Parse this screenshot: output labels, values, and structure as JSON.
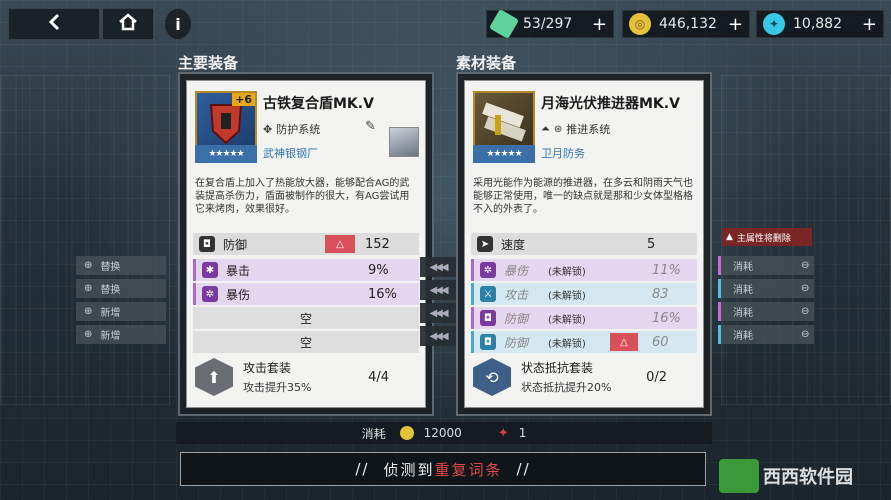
{
  "topbar": {
    "back_icon": "back-arrow-icon",
    "home_icon": "home-icon",
    "info_icon": "info-icon",
    "resources": [
      {
        "name": "energy",
        "value": "53/297",
        "color": "#5fd39b"
      },
      {
        "name": "coins",
        "value": "446,132",
        "color": "#e2c23a"
      },
      {
        "name": "crystals",
        "value": "10,882",
        "color": "#36c8e6"
      }
    ]
  },
  "sections": {
    "main_title": "主要装备",
    "material_title": "素材装备"
  },
  "main_item": {
    "level": "+6",
    "name": "古铁复合盾MK.V",
    "system": "防护系统",
    "stars": "★★★★★",
    "maker": "武神银钢厂",
    "description": "在复合盾上加入了热能放大器，能够配合AG的武装提高杀伤力，盾面被制作的很大，有AG尝试用它来烤肉，效果很好。",
    "main_stat": {
      "label": "防御",
      "value": "152"
    },
    "sub_stats": [
      {
        "label": "暴击",
        "value": "9%"
      },
      {
        "label": "暴伤",
        "value": "16%"
      },
      {
        "label": "空",
        "value": ""
      },
      {
        "label": "空",
        "value": ""
      }
    ],
    "suit": {
      "name": "攻击套装",
      "desc": "攻击提升35%",
      "count": "4/4"
    }
  },
  "material_item": {
    "name": "月海光伏推进器MK.V",
    "system": "推进系统",
    "stars": "★★★★★",
    "maker": "卫月防务",
    "description": "采用光能作为能源的推进器，在多云和阴雨天气也能够正常使用，唯一的缺点就是那和少女体型格格不入的外表了。",
    "main_stat": {
      "label": "速度",
      "value": "5"
    },
    "sub_stats": [
      {
        "label": "暴伤",
        "state": "(未解锁)",
        "value": "11%"
      },
      {
        "label": "攻击",
        "state": "(未解锁)",
        "value": "83"
      },
      {
        "label": "防御",
        "state": "(未解锁)",
        "value": "16%"
      },
      {
        "label": "防御",
        "state": "(未解锁)",
        "value": "60"
      }
    ],
    "suit": {
      "name": "状态抵抗套装",
      "desc": "状态抵抗提升20%",
      "count": "0/2"
    }
  },
  "left_side": [
    "替换",
    "替换",
    "新增",
    "新增"
  ],
  "right_side": [
    "消耗",
    "消耗",
    "消耗",
    "消耗"
  ],
  "warning_badge": "主属性将删除",
  "cost": {
    "label": "消耗",
    "coins": "12000",
    "material": "1"
  },
  "detect_button": {
    "prefix": "//",
    "text_a": "侦测到",
    "text_b": "重复词条",
    "suffix": "//",
    "highlight_color": "#e04848"
  },
  "watermark": "西西软件园"
}
